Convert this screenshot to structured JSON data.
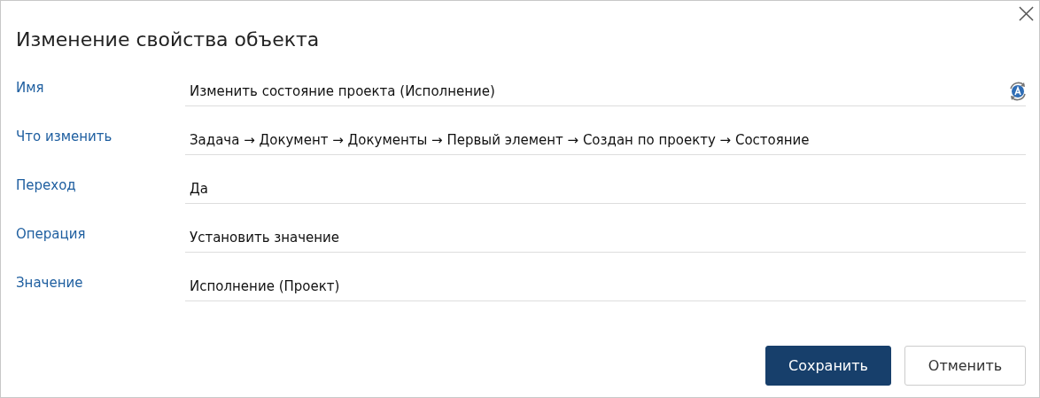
{
  "dialog": {
    "title": "Изменение свойства объекта"
  },
  "fields": [
    {
      "label": "Имя",
      "value": "Изменить состояние проекта (Исполнение)",
      "auto": true
    },
    {
      "label": "Что изменить",
      "value": "Задача → Документ → Документы → Первый элемент → Создан по проекту → Состояние",
      "auto": false
    },
    {
      "label": "Переход",
      "value": "Да",
      "auto": false
    },
    {
      "label": "Операция",
      "value": "Установить значение",
      "auto": false
    },
    {
      "label": "Значение",
      "value": "Исполнение (Проект)",
      "auto": false
    }
  ],
  "buttons": [
    {
      "label": "Сохранить",
      "kind": "primary"
    },
    {
      "label": "Отменить",
      "kind": "secondary"
    }
  ]
}
